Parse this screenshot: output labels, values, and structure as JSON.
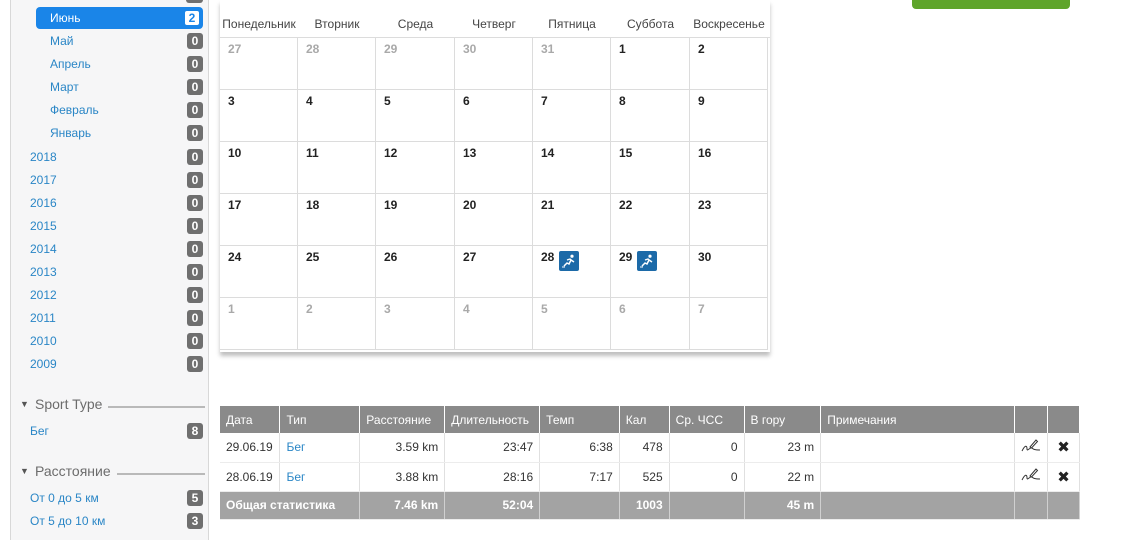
{
  "sidebar": {
    "months": [
      {
        "label": "Июнь",
        "count": "2",
        "active": true
      },
      {
        "label": "Май",
        "count": "0"
      },
      {
        "label": "Апрель",
        "count": "0"
      },
      {
        "label": "Март",
        "count": "0"
      },
      {
        "label": "Февраль",
        "count": "0"
      },
      {
        "label": "Январь",
        "count": "0"
      }
    ],
    "years": [
      {
        "label": "2018",
        "count": "0"
      },
      {
        "label": "2017",
        "count": "0"
      },
      {
        "label": "2016",
        "count": "0"
      },
      {
        "label": "2015",
        "count": "0"
      },
      {
        "label": "2014",
        "count": "0"
      },
      {
        "label": "2013",
        "count": "0"
      },
      {
        "label": "2012",
        "count": "0"
      },
      {
        "label": "2011",
        "count": "0"
      },
      {
        "label": "2010",
        "count": "0"
      },
      {
        "label": "2009",
        "count": "0"
      }
    ],
    "sport_type": {
      "title": "Sport Type",
      "items": [
        {
          "label": "Бег",
          "count": "8"
        }
      ]
    },
    "distance": {
      "title": "Расстояние",
      "items": [
        {
          "label": "От 0 до 5 км",
          "count": "5"
        },
        {
          "label": "От 5 до 10 км",
          "count": "3"
        }
      ]
    }
  },
  "calendar": {
    "weekdays": [
      "Понедельник",
      "Вторник",
      "Среда",
      "Четверг",
      "Пятница",
      "Суббота",
      "Воскресенье"
    ],
    "weeks": [
      [
        {
          "d": "27",
          "o": true
        },
        {
          "d": "28",
          "o": true
        },
        {
          "d": "29",
          "o": true
        },
        {
          "d": "30",
          "o": true
        },
        {
          "d": "31",
          "o": true
        },
        {
          "d": "1"
        },
        {
          "d": "2"
        }
      ],
      [
        {
          "d": "3"
        },
        {
          "d": "4"
        },
        {
          "d": "5"
        },
        {
          "d": "6"
        },
        {
          "d": "7"
        },
        {
          "d": "8"
        },
        {
          "d": "9"
        }
      ],
      [
        {
          "d": "10"
        },
        {
          "d": "11"
        },
        {
          "d": "12"
        },
        {
          "d": "13"
        },
        {
          "d": "14"
        },
        {
          "d": "15"
        },
        {
          "d": "16"
        }
      ],
      [
        {
          "d": "17"
        },
        {
          "d": "18"
        },
        {
          "d": "19"
        },
        {
          "d": "20"
        },
        {
          "d": "21"
        },
        {
          "d": "22"
        },
        {
          "d": "23"
        }
      ],
      [
        {
          "d": "24"
        },
        {
          "d": "25"
        },
        {
          "d": "26"
        },
        {
          "d": "27"
        },
        {
          "d": "28",
          "run": true
        },
        {
          "d": "29",
          "run": true
        },
        {
          "d": "30"
        }
      ],
      [
        {
          "d": "1",
          "o": true
        },
        {
          "d": "2",
          "o": true
        },
        {
          "d": "3",
          "o": true
        },
        {
          "d": "4",
          "o": true
        },
        {
          "d": "5",
          "o": true
        },
        {
          "d": "6",
          "o": true
        },
        {
          "d": "7",
          "o": true
        }
      ]
    ],
    "event_icon": "runner-icon"
  },
  "table": {
    "headers": [
      "Дата",
      "Тип",
      "Расстояние",
      "Длительность",
      "Темп",
      "Кал",
      "Ср. ЧСС",
      "В гору",
      "Примечания",
      "",
      ""
    ],
    "rows": [
      {
        "date": "29.06.19",
        "type": "Бег",
        "distance": "3.59 km",
        "duration": "23:47",
        "pace": "6:38",
        "cal": "478",
        "hr": "0",
        "climb": "23 m",
        "notes": ""
      },
      {
        "date": "28.06.19",
        "type": "Бег",
        "distance": "3.88 km",
        "duration": "28:16",
        "pace": "7:17",
        "cal": "525",
        "hr": "0",
        "climb": "22 m",
        "notes": ""
      }
    ],
    "total": {
      "label": "Общая статистика",
      "distance": "7.46 km",
      "duration": "52:04",
      "pace": "",
      "cal": "1003",
      "hr": "",
      "climb": "45 m"
    }
  },
  "colors": {
    "accent": "#1a85e8",
    "link": "#2a86c6",
    "badge": "#6f6f6f",
    "header": "#8a8a8a",
    "total": "#a3a3a3",
    "button": "#5fa52b"
  }
}
